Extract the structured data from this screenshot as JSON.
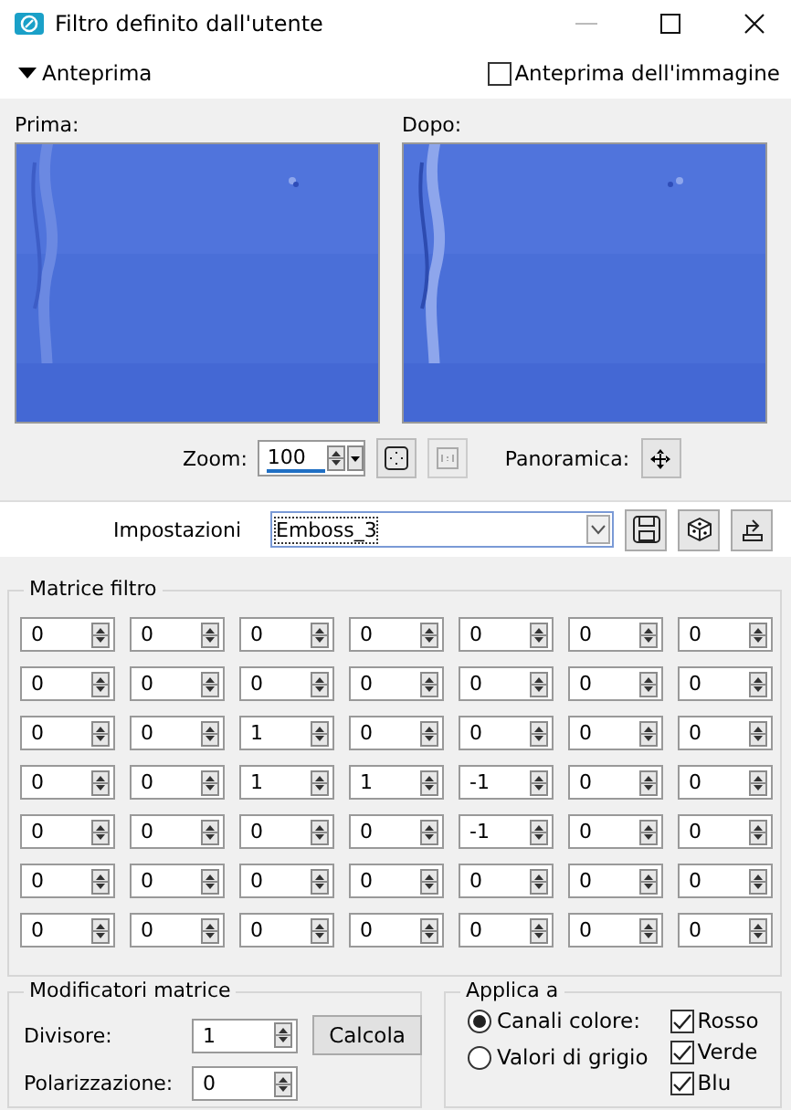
{
  "window": {
    "title": "Filtro definito dall'utente"
  },
  "preview": {
    "label": "Anteprima",
    "expanded": true,
    "image_preview": {
      "label": "Anteprima dell'immagine",
      "checked": false
    },
    "before": {
      "label": "Prima:",
      "kind": "picture"
    },
    "after": {
      "label": "Dopo:",
      "kind": "picture"
    },
    "zoom": {
      "label": "Zoom:",
      "value": "100"
    },
    "pan": {
      "label": "Panoramica:"
    }
  },
  "settings": {
    "label": "Impostazioni",
    "value": "Emboss_3"
  },
  "matrix": {
    "title": "Matrice filtro",
    "rows": [
      [
        "0",
        "0",
        "0",
        "0",
        "0",
        "0",
        "0"
      ],
      [
        "0",
        "0",
        "0",
        "0",
        "0",
        "0",
        "0"
      ],
      [
        "0",
        "0",
        "1",
        "0",
        "0",
        "0",
        "0"
      ],
      [
        "0",
        "0",
        "1",
        "1",
        "-1",
        "0",
        "0"
      ],
      [
        "0",
        "0",
        "0",
        "0",
        "-1",
        "0",
        "0"
      ],
      [
        "0",
        "0",
        "0",
        "0",
        "0",
        "0",
        "0"
      ],
      [
        "0",
        "0",
        "0",
        "0",
        "0",
        "0",
        "0"
      ]
    ]
  },
  "modifiers": {
    "title": "Modificatori matrice",
    "divisor": {
      "label": "Divisore:",
      "value": "1"
    },
    "button": "Calcola",
    "bias": {
      "label": "Polarizzazione:",
      "value": "0"
    }
  },
  "apply": {
    "title": "Applica a",
    "modes": [
      {
        "label": "Canali colore:",
        "selected": true
      },
      {
        "label": "Valori di grigio",
        "selected": false
      }
    ],
    "channels": [
      {
        "label": "Rosso",
        "checked": true
      },
      {
        "label": "Verde",
        "checked": true
      },
      {
        "label": "Blu",
        "checked": true
      }
    ]
  }
}
